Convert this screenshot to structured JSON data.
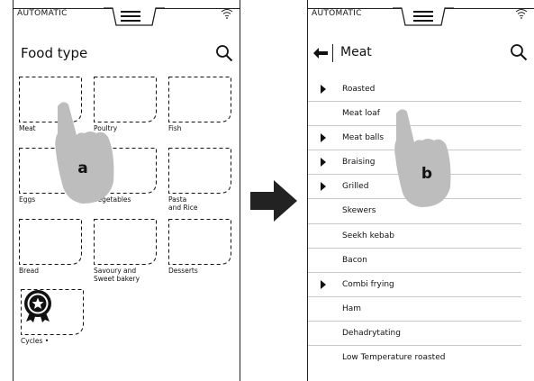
{
  "left_screen": {
    "mode": "AUTOMATIC",
    "title": "Food type",
    "icons": {
      "menu": "hamburger-icon",
      "wifi": "wifi-icon",
      "search": "search-icon"
    },
    "tiles": [
      {
        "label": "Meat"
      },
      {
        "label": "Poultry"
      },
      {
        "label": "Fish"
      },
      {
        "label": "Eggs"
      },
      {
        "label": "Vegetables"
      },
      {
        "label": "Pasta\nand Rice"
      },
      {
        "label": "Bread"
      },
      {
        "label": "Savoury and\nSweet bakery"
      },
      {
        "label": "Desserts"
      },
      {
        "label": "Cycles •",
        "icon": "medal-icon"
      }
    ],
    "callout": "a"
  },
  "right_screen": {
    "mode": "AUTOMATIC",
    "title": "Meat",
    "icons": {
      "back": "back-arrow-icon",
      "menu": "hamburger-icon",
      "wifi": "wifi-icon",
      "search": "search-icon"
    },
    "items": [
      {
        "label": "Roasted",
        "submenu": true
      },
      {
        "label": "Meat loaf",
        "submenu": false
      },
      {
        "label": "Meat balls",
        "submenu": true
      },
      {
        "label": "Braising",
        "submenu": true
      },
      {
        "label": "Grilled",
        "submenu": true
      },
      {
        "label": "Skewers",
        "submenu": false
      },
      {
        "label": "Seekh kebab",
        "submenu": false
      },
      {
        "label": "Bacon",
        "submenu": false
      },
      {
        "label": "Combi frying",
        "submenu": true
      },
      {
        "label": "Ham",
        "submenu": false
      },
      {
        "label": "Dehadrytating",
        "submenu": false
      },
      {
        "label": "Low Temperature roasted",
        "submenu": false
      }
    ],
    "callout": "b"
  },
  "transition_icon": "right-arrow-icon"
}
